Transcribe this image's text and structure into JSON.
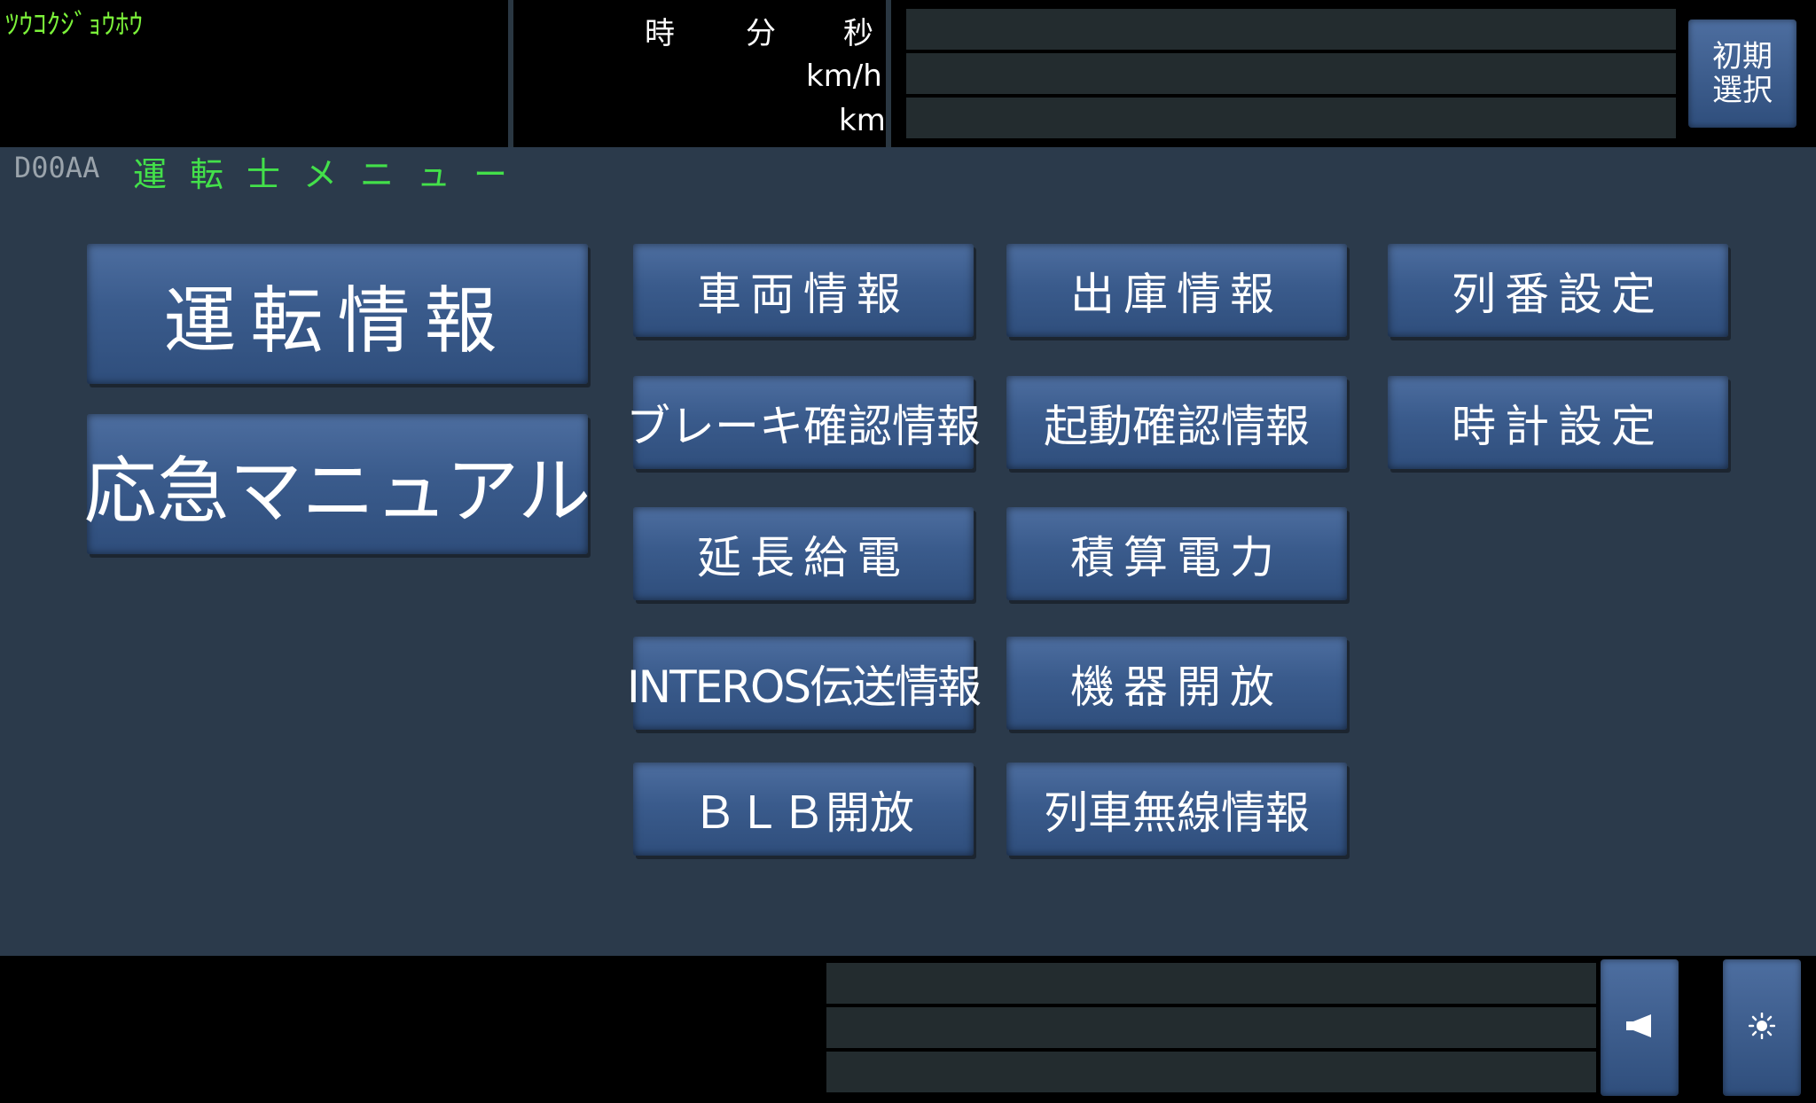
{
  "header": {
    "status_text": "ﾂｳｺｸｼﾞｮｳﾎｳ",
    "time_labels": {
      "hour": "時",
      "minute": "分",
      "second": "秒"
    },
    "speed_unit": "km/h",
    "distance_unit": "km",
    "init_select_label": "初期\n選択"
  },
  "screen": {
    "id": "D00AA",
    "title": "運転士メニュー"
  },
  "menu": {
    "driving_info": "運転情報",
    "emergency_manual": "応急マニュアル",
    "vehicle_info": "車両情報",
    "brake_check_info": "ブレーキ確認情報",
    "extension_power": "延長給電",
    "interos_info": "INTEROS伝送情報",
    "blb_open": "ＢＬＢ開放",
    "depot_info": "出庫情報",
    "startup_check_info": "起動確認情報",
    "integrated_power": "積算電力",
    "equipment_open": "機器開放",
    "train_radio_info": "列車無線情報",
    "train_number_setting": "列番設定",
    "clock_setting": "時計設定"
  },
  "footer": {
    "horn_icon": "horn-icon",
    "brightness_icon": "brightness-icon"
  }
}
